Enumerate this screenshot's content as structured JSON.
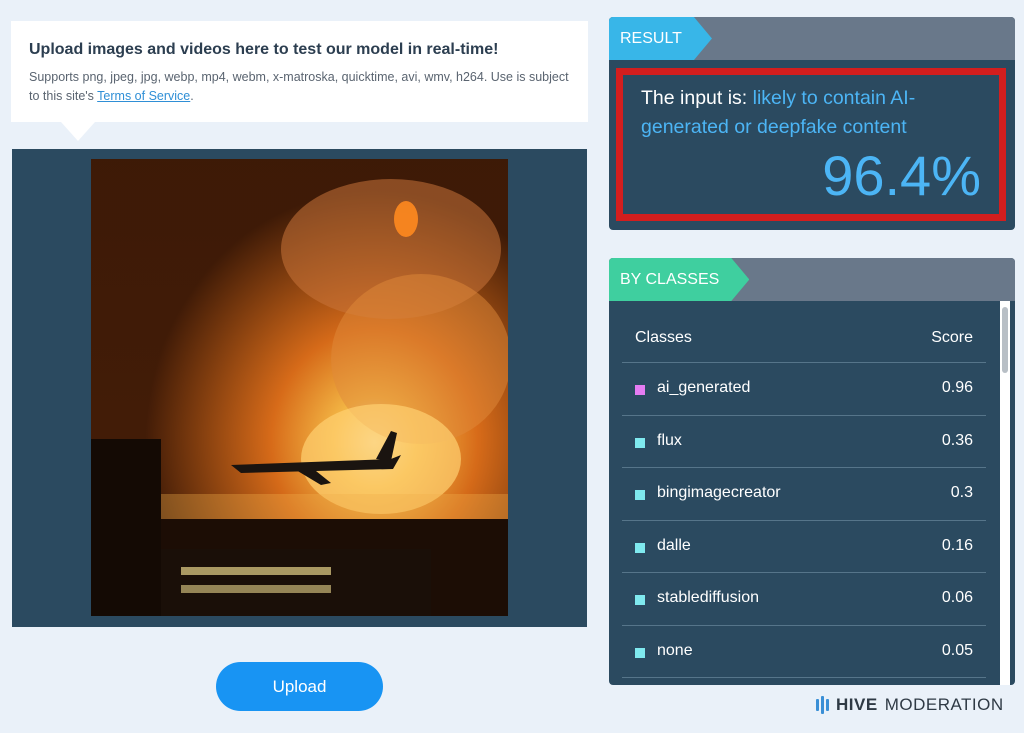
{
  "info": {
    "title": "Upload images and videos here to test our model in real-time!",
    "supports_text": "Supports png, jpeg, jpg, webp, mp4, webm, x-matroska, quicktime, avi, wmv, h264. Use is subject to this site's ",
    "terms_link": "Terms of Service",
    "period": "."
  },
  "upload": {
    "label": "Upload"
  },
  "result": {
    "tab_label": "RESULT",
    "prefix": "The input is: ",
    "verdict": "likely to contain AI-generated or deepfake content",
    "score": "96.4%"
  },
  "classes": {
    "tab_label": "BY CLASSES",
    "col_class": "Classes",
    "col_score": "Score",
    "rows": [
      {
        "name": "ai_generated",
        "score": "0.96",
        "color": "#e47cf2"
      },
      {
        "name": "flux",
        "score": "0.36",
        "color": "#7fe9ef"
      },
      {
        "name": "bingimagecreator",
        "score": "0.3",
        "color": "#7fe9ef"
      },
      {
        "name": "dalle",
        "score": "0.16",
        "color": "#7fe9ef"
      },
      {
        "name": "stablediffusion",
        "score": "0.06",
        "color": "#7fe9ef"
      },
      {
        "name": "none",
        "score": "0.05",
        "color": "#7fe9ef"
      }
    ]
  },
  "brand": {
    "strong": "HIVE",
    "light": "MODERATION",
    "icon": "hive-logo-icon"
  }
}
